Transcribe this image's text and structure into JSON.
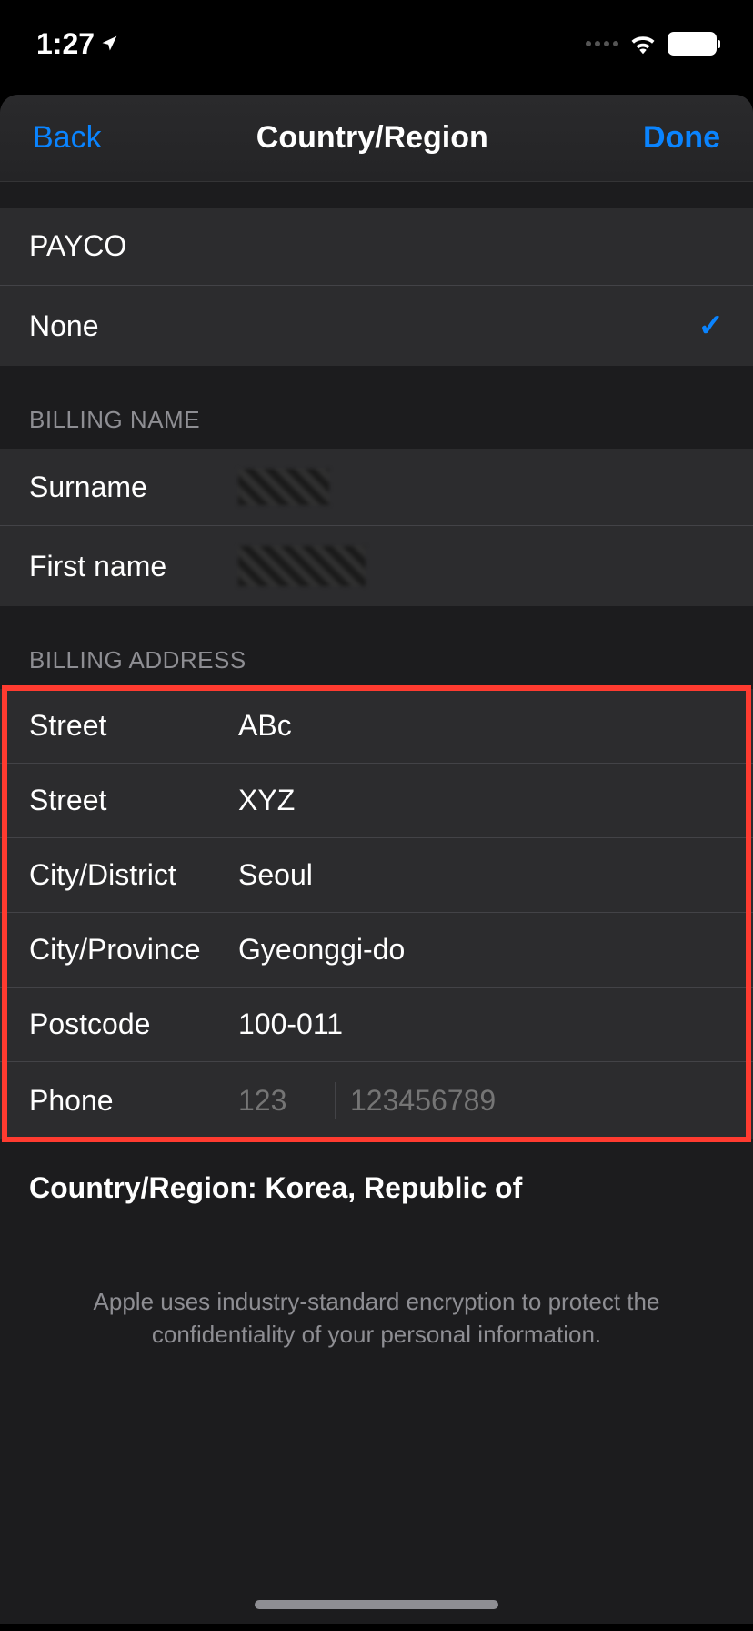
{
  "status": {
    "time": "1:27"
  },
  "nav": {
    "back": "Back",
    "title": "Country/Region",
    "done": "Done"
  },
  "payment_options": [
    {
      "label": "PAYCO",
      "selected": false
    },
    {
      "label": "None",
      "selected": true
    }
  ],
  "sections": {
    "billing_name": {
      "header": "BILLING NAME",
      "fields": [
        {
          "label": "Surname",
          "value": ""
        },
        {
          "label": "First name",
          "value": ""
        }
      ]
    },
    "billing_address": {
      "header": "BILLING ADDRESS",
      "fields": [
        {
          "label": "Street",
          "value": "ABc"
        },
        {
          "label": "Street",
          "value": "XYZ"
        },
        {
          "label": "City/District",
          "value": "Seoul"
        },
        {
          "label": "City/Province",
          "value": "Gyeonggi-do"
        },
        {
          "label": "Postcode",
          "value": "100-011"
        }
      ],
      "phone": {
        "label": "Phone",
        "prefix_placeholder": "123",
        "number_placeholder": "123456789"
      }
    }
  },
  "country_region": {
    "label": "Country/Region: ",
    "value": "Korea, Republic of"
  },
  "footer": "Apple uses industry-standard encryption to protect the confidentiality of your personal information."
}
